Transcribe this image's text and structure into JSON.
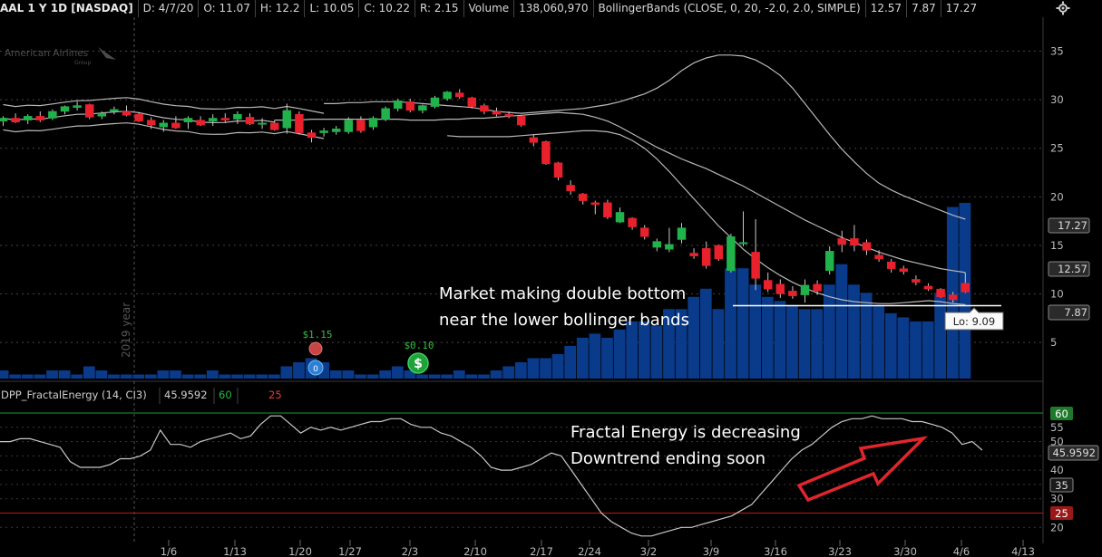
{
  "header": {
    "symbol": "AAL 1 Y 1D [NASDAQ]",
    "date": "D: 4/7/20",
    "open": "O: 11.07",
    "high": "H: 12.2",
    "low": "L: 10.05",
    "close": "C: 10.22",
    "range": "R: 2.15",
    "volume_label": "Volume",
    "volume_value": "138,060,970",
    "study": "BollingerBands (CLOSE, 0, 20, -2.0, 2.0, SIMPLE)",
    "band_lower": "12.57",
    "band_mid": "7.87",
    "band_upper": "17.27"
  },
  "logo": {
    "name": "American Airlines",
    "sub": "Group"
  },
  "year_label": "2019 year",
  "lower_panel": {
    "study_label": "DPP_FractalEnergy (14, CI3)",
    "value": "45.9592",
    "level_high": "60",
    "level_low": "25"
  },
  "annotations": {
    "double_bottom_line1": "Market making double bottom",
    "double_bottom_line2": "near the lower bollinger bands",
    "fractal_line1": "Fractal Energy is decreasing",
    "fractal_line2": "Downtrend ending soon",
    "low_bubble": "Lo: 9.09",
    "dividend1": "$1.15",
    "dividend2": "$0.10"
  },
  "colors": {
    "up": "#21b24b",
    "down": "#e8212d",
    "volume": "#0a3a8a",
    "band": "#b8b8b8",
    "level60": "#1e7a2a",
    "level25": "#9b1818",
    "arrow": "#e0262c"
  },
  "chart_data": [
    {
      "type": "candlestick",
      "title": "AAL 1 Y 1D [NASDAQ]",
      "x_ticks": [
        "1/6",
        "1/13",
        "1/20",
        "1/27",
        "2/3",
        "2/10",
        "2/17",
        "2/24",
        "3/2",
        "3/9",
        "3/16",
        "3/23",
        "3/30",
        "4/6",
        "4/13"
      ],
      "y_ticks": [
        5,
        10,
        15,
        20,
        25,
        30,
        35
      ],
      "ylim": [
        1,
        38.5
      ],
      "price_labels": [
        "17.27",
        "12.57",
        "7.87"
      ],
      "candles": [
        {
          "o": 27.8,
          "h": 28.3,
          "l": 27.3,
          "c": 28.1
        },
        {
          "o": 28.1,
          "h": 28.6,
          "l": 27.6,
          "c": 27.7
        },
        {
          "o": 27.9,
          "h": 28.5,
          "l": 27.5,
          "c": 28.3
        },
        {
          "o": 28.3,
          "h": 28.8,
          "l": 27.7,
          "c": 27.9
        },
        {
          "o": 28.1,
          "h": 29.0,
          "l": 27.9,
          "c": 28.8
        },
        {
          "o": 28.8,
          "h": 29.4,
          "l": 28.5,
          "c": 29.3
        },
        {
          "o": 29.2,
          "h": 29.8,
          "l": 28.9,
          "c": 29.4
        },
        {
          "o": 29.5,
          "h": 29.6,
          "l": 28.0,
          "c": 28.2
        },
        {
          "o": 28.3,
          "h": 28.8,
          "l": 28.0,
          "c": 28.6
        },
        {
          "o": 28.8,
          "h": 29.3,
          "l": 28.5,
          "c": 29.0
        },
        {
          "o": 28.8,
          "h": 29.4,
          "l": 28.3,
          "c": 28.4
        },
        {
          "o": 28.5,
          "h": 28.7,
          "l": 27.7,
          "c": 27.8
        },
        {
          "o": 27.9,
          "h": 28.2,
          "l": 27.0,
          "c": 27.4
        },
        {
          "o": 27.2,
          "h": 27.9,
          "l": 26.7,
          "c": 27.6
        },
        {
          "o": 27.6,
          "h": 28.3,
          "l": 27.0,
          "c": 27.1
        },
        {
          "o": 27.7,
          "h": 28.3,
          "l": 27.0,
          "c": 28.1
        },
        {
          "o": 27.9,
          "h": 28.3,
          "l": 27.3,
          "c": 27.4
        },
        {
          "o": 27.8,
          "h": 28.5,
          "l": 27.3,
          "c": 28.1
        },
        {
          "o": 28.1,
          "h": 28.6,
          "l": 27.6,
          "c": 27.9
        },
        {
          "o": 28.0,
          "h": 28.8,
          "l": 27.5,
          "c": 28.5
        },
        {
          "o": 28.2,
          "h": 28.6,
          "l": 27.4,
          "c": 27.5
        },
        {
          "o": 27.5,
          "h": 28.1,
          "l": 27.0,
          "c": 27.6
        },
        {
          "o": 27.6,
          "h": 27.9,
          "l": 26.8,
          "c": 26.9
        },
        {
          "o": 27.1,
          "h": 29.6,
          "l": 26.5,
          "c": 28.9
        },
        {
          "o": 28.5,
          "h": 28.8,
          "l": 26.4,
          "c": 26.6
        },
        {
          "o": 26.6,
          "h": 26.9,
          "l": 25.6,
          "c": 26.1
        },
        {
          "o": 26.6,
          "h": 27.1,
          "l": 26.2,
          "c": 26.8
        },
        {
          "o": 26.7,
          "h": 27.3,
          "l": 26.4,
          "c": 27.0
        },
        {
          "o": 26.7,
          "h": 28.2,
          "l": 26.5,
          "c": 27.9
        },
        {
          "o": 27.9,
          "h": 28.3,
          "l": 26.6,
          "c": 26.8
        },
        {
          "o": 27.2,
          "h": 28.3,
          "l": 26.9,
          "c": 28.1
        },
        {
          "o": 28.0,
          "h": 29.3,
          "l": 27.8,
          "c": 29.1
        },
        {
          "o": 29.1,
          "h": 30.1,
          "l": 28.8,
          "c": 29.9
        },
        {
          "o": 29.8,
          "h": 30.1,
          "l": 28.7,
          "c": 28.9
        },
        {
          "o": 28.9,
          "h": 29.5,
          "l": 28.6,
          "c": 29.4
        },
        {
          "o": 29.3,
          "h": 30.4,
          "l": 29.1,
          "c": 30.2
        },
        {
          "o": 30.1,
          "h": 30.9,
          "l": 29.9,
          "c": 30.8
        },
        {
          "o": 30.7,
          "h": 31.1,
          "l": 30.1,
          "c": 30.3
        },
        {
          "o": 30.2,
          "h": 30.3,
          "l": 29.1,
          "c": 29.3
        },
        {
          "o": 29.4,
          "h": 29.6,
          "l": 28.5,
          "c": 28.8
        },
        {
          "o": 28.8,
          "h": 29.2,
          "l": 28.3,
          "c": 28.5
        },
        {
          "o": 28.5,
          "h": 28.8,
          "l": 28.1,
          "c": 28.3
        },
        {
          "o": 28.3,
          "h": 28.4,
          "l": 27.2,
          "c": 27.4
        },
        {
          "o": 26.1,
          "h": 26.4,
          "l": 25.2,
          "c": 25.6
        },
        {
          "o": 25.7,
          "h": 25.8,
          "l": 23.3,
          "c": 23.4
        },
        {
          "o": 23.5,
          "h": 23.6,
          "l": 21.7,
          "c": 22.0
        },
        {
          "o": 21.2,
          "h": 21.7,
          "l": 20.2,
          "c": 20.6
        },
        {
          "o": 20.3,
          "h": 20.4,
          "l": 19.2,
          "c": 19.6
        },
        {
          "o": 19.4,
          "h": 19.6,
          "l": 18.2,
          "c": 19.2
        },
        {
          "o": 19.4,
          "h": 19.7,
          "l": 17.7,
          "c": 17.9
        },
        {
          "o": 17.4,
          "h": 18.9,
          "l": 17.3,
          "c": 18.4
        },
        {
          "o": 17.8,
          "h": 17.9,
          "l": 16.6,
          "c": 16.9
        },
        {
          "o": 16.8,
          "h": 17.1,
          "l": 15.6,
          "c": 15.9
        },
        {
          "o": 14.8,
          "h": 15.7,
          "l": 14.4,
          "c": 15.4
        },
        {
          "o": 14.6,
          "h": 16.8,
          "l": 14.3,
          "c": 15.1
        },
        {
          "o": 15.6,
          "h": 17.3,
          "l": 15.2,
          "c": 16.8
        },
        {
          "o": 14.2,
          "h": 14.7,
          "l": 13.6,
          "c": 13.9
        },
        {
          "o": 14.7,
          "h": 15.4,
          "l": 12.6,
          "c": 12.9
        },
        {
          "o": 15.0,
          "h": 15.1,
          "l": 13.4,
          "c": 13.6
        },
        {
          "o": 12.4,
          "h": 16.2,
          "l": 12.2,
          "c": 15.9
        },
        {
          "o": 15.2,
          "h": 18.5,
          "l": 14.9,
          "c": 15.3
        },
        {
          "o": 14.3,
          "h": 17.7,
          "l": 10.4,
          "c": 11.6
        },
        {
          "o": 11.4,
          "h": 12.2,
          "l": 10.2,
          "c": 10.5
        },
        {
          "o": 11.0,
          "h": 11.5,
          "l": 9.6,
          "c": 10.0
        },
        {
          "o": 10.3,
          "h": 10.8,
          "l": 9.5,
          "c": 9.8
        },
        {
          "o": 9.9,
          "h": 11.5,
          "l": 9.1,
          "c": 10.9
        },
        {
          "o": 11.0,
          "h": 11.4,
          "l": 9.9,
          "c": 10.3
        },
        {
          "o": 12.4,
          "h": 14.9,
          "l": 12.0,
          "c": 14.4
        },
        {
          "o": 15.7,
          "h": 16.5,
          "l": 14.3,
          "c": 15.1
        },
        {
          "o": 15.7,
          "h": 17.1,
          "l": 14.4,
          "c": 15.0
        },
        {
          "o": 15.3,
          "h": 15.6,
          "l": 14.0,
          "c": 14.5
        },
        {
          "o": 14.0,
          "h": 14.5,
          "l": 13.3,
          "c": 13.6
        },
        {
          "o": 13.3,
          "h": 13.6,
          "l": 12.2,
          "c": 12.6
        },
        {
          "o": 12.6,
          "h": 12.9,
          "l": 12.0,
          "c": 12.3
        },
        {
          "o": 11.5,
          "h": 11.9,
          "l": 10.9,
          "c": 11.2
        },
        {
          "o": 10.8,
          "h": 11.1,
          "l": 10.3,
          "c": 10.5
        },
        {
          "o": 10.5,
          "h": 10.6,
          "l": 9.6,
          "c": 9.7
        },
        {
          "o": 9.9,
          "h": 10.2,
          "l": 9.1,
          "c": 9.4
        },
        {
          "o": 11.1,
          "h": 12.2,
          "l": 10.1,
          "c": 10.2
        }
      ],
      "bollinger_upper": [
        29.6,
        29.6,
        29.7,
        29.7,
        29.8,
        29.8,
        29.8,
        29.7,
        29.6,
        29.5,
        29.4,
        29.3,
        29.2,
        29.0,
        28.8,
        28.7,
        28.6,
        28.7,
        28.8,
        28.9,
        29.0,
        29.1,
        29.3,
        29.5,
        29.8,
        30.2,
        30.6,
        31.2,
        32.0,
        33.0,
        33.8,
        34.3,
        34.6,
        34.6,
        34.5,
        34.1,
        33.4,
        32.5,
        31.2,
        29.6,
        28.0,
        26.4,
        24.9,
        23.6,
        22.4,
        21.4,
        20.7,
        20.1,
        19.6,
        19.1,
        18.6,
        18.1,
        17.7
      ],
      "bollinger_upper_start": 26,
      "bollinger_mid": [
        27.9,
        27.9,
        27.9,
        28.0,
        28.0,
        28.0,
        28.0,
        28.0,
        28.0,
        28.0,
        28.0,
        27.9,
        27.9,
        27.9,
        28.0,
        28.0,
        28.1,
        28.1,
        28.2,
        28.3,
        28.4,
        28.5,
        28.6,
        28.7,
        28.6,
        28.5,
        28.2,
        27.8,
        27.2,
        26.5,
        25.8,
        25.1,
        24.5,
        23.9,
        23.4,
        22.9,
        22.3,
        21.7,
        21.1,
        20.4,
        19.7,
        19.0,
        18.3,
        17.6,
        17.0,
        16.4,
        15.8,
        15.3,
        14.8,
        14.3,
        13.9,
        13.5,
        13.2,
        12.9,
        12.6,
        12.4,
        12.2
      ],
      "bollinger_mid_start": 22,
      "bollinger_lower": [
        26.3,
        26.2,
        26.2,
        26.2,
        26.2,
        26.2,
        26.3,
        26.4,
        26.5,
        26.6,
        26.7,
        26.8,
        26.8,
        26.7,
        26.4,
        25.8,
        25.0,
        23.9,
        22.6,
        21.2,
        19.8,
        18.4,
        17.0,
        15.8,
        14.6,
        13.6,
        12.7,
        11.9,
        11.2,
        10.6,
        10.1,
        9.7,
        9.4,
        9.2,
        9.1,
        9.0,
        9.0,
        9.1,
        9.2,
        9.3,
        9.2,
        9.0,
        8.9
      ],
      "bollinger_lower_start": 36
    },
    {
      "type": "bar",
      "ylabel": "Volume",
      "values": [
        2,
        1,
        1,
        1,
        2,
        2,
        1,
        3,
        2,
        1,
        1,
        1,
        1,
        2,
        2,
        1,
        1,
        2,
        1,
        1,
        1,
        1,
        1,
        3,
        4,
        5,
        4,
        2,
        2,
        1,
        1,
        2,
        3,
        2,
        1,
        1,
        1,
        2,
        1,
        1,
        2,
        3,
        4,
        5,
        5,
        6,
        8,
        10,
        11,
        10,
        12,
        14,
        14,
        13,
        17,
        17,
        20,
        22,
        17,
        27,
        27,
        23,
        20,
        19,
        18,
        17,
        17,
        23,
        28,
        23,
        21,
        18,
        16,
        15,
        14,
        14,
        21,
        42,
        43
      ],
      "ylim": [
        0,
        45
      ]
    },
    {
      "type": "line",
      "ylabel": "DPP_FractalEnergy (14, CI3)",
      "y_ticks": [
        20,
        25,
        30,
        35,
        40,
        45,
        50,
        55,
        60
      ],
      "ylim": [
        17,
        62
      ],
      "levels": [
        60,
        25
      ],
      "value_labels": [
        "60",
        "45.9592",
        "35",
        "25"
      ],
      "values": [
        50,
        50,
        51,
        51,
        50,
        49,
        48,
        43,
        41,
        41,
        41,
        42,
        44,
        44,
        45,
        47,
        54,
        49,
        49,
        48,
        50,
        51,
        52,
        53,
        51,
        52,
        56,
        59,
        59,
        56,
        53,
        55,
        54,
        55,
        54,
        55,
        56,
        57,
        57,
        58,
        58,
        56,
        55,
        55,
        53,
        52,
        50,
        48,
        45,
        41,
        40,
        40,
        41,
        42,
        44,
        46,
        45,
        40,
        35,
        30,
        25,
        22,
        20,
        18,
        17,
        17,
        18,
        19,
        20,
        20,
        21,
        22,
        23,
        24,
        26,
        28,
        32,
        36,
        40,
        44,
        47,
        49,
        52,
        55,
        57,
        58,
        58,
        59,
        58,
        58,
        58,
        57,
        57,
        56,
        55,
        53,
        49,
        50,
        47
      ]
    }
  ]
}
